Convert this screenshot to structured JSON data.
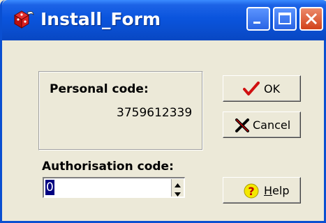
{
  "window": {
    "title": "Install_Form",
    "icon": "install-icon",
    "controls": [
      "minimize-icon",
      "maximize-icon",
      "close-icon"
    ]
  },
  "personal": {
    "label": "Personal code:",
    "value": "3759612339"
  },
  "authorisation": {
    "label": "Authorisation code:",
    "value": "0"
  },
  "buttons": {
    "ok": {
      "label": "OK",
      "icon": "checkmark-icon"
    },
    "cancel": {
      "label": "Cancel",
      "icon": "cross-icon"
    },
    "help": {
      "label_hotkey": "H",
      "label_rest": "elp",
      "icon": "help-icon"
    }
  },
  "colors": {
    "titlebar": "#0a4fd1",
    "face": "#ece9d8",
    "selection": "#000080"
  }
}
